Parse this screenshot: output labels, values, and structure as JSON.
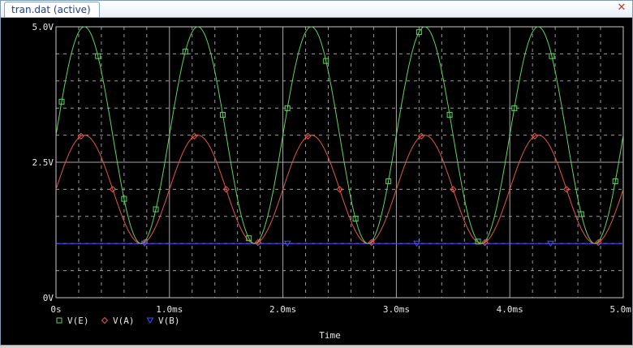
{
  "window": {
    "tab_title": "tran.dat (active)",
    "close_icon": "close-icon"
  },
  "colors": {
    "background": "#000000",
    "grid_solid": "#a8a8a8",
    "grid_dotted": "#9a9a9a",
    "axis_text": "#e6e6e6",
    "series_e": "#5fd35f",
    "series_a": "#e0584b",
    "series_b": "#4a4aff"
  },
  "chart_data": {
    "type": "line",
    "xlabel": "Time",
    "ylabel": "",
    "xlim": [
      0,
      5.0
    ],
    "ylim": [
      0,
      5.0
    ],
    "x_ticks": [
      0,
      1.0,
      2.0,
      3.0,
      4.0,
      5.0
    ],
    "x_tick_labels": [
      "0s",
      "1.0ms",
      "2.0ms",
      "3.0ms",
      "4.0ms",
      "5.0ms"
    ],
    "y_ticks": [
      0,
      2.5,
      5.0
    ],
    "y_tick_labels": [
      "0V",
      "2.5V",
      "5.0V"
    ],
    "x_unit": "ms",
    "grid": true,
    "legend_position": "bottom-left",
    "series": [
      {
        "name": "V(E)",
        "marker": "square",
        "color": "#5fd35f",
        "x": [
          0,
          0.125,
          0.25,
          0.375,
          0.5,
          0.625,
          0.75,
          0.875,
          1.0,
          1.125,
          1.25,
          1.375,
          1.5,
          1.625,
          1.75,
          1.875,
          2.0,
          2.125,
          2.25,
          2.375,
          2.5,
          2.625,
          2.75,
          2.875,
          3.0,
          3.125,
          3.25,
          3.375,
          3.5,
          3.625,
          3.75,
          3.875,
          4.0,
          4.125,
          4.25,
          4.375,
          4.5,
          4.625,
          4.75,
          4.875,
          5.0
        ],
        "y": [
          3.0,
          4.41,
          5.0,
          4.41,
          3.0,
          1.59,
          1.0,
          1.59,
          3.0,
          4.41,
          5.0,
          4.41,
          3.0,
          1.59,
          1.0,
          1.59,
          3.0,
          4.41,
          5.0,
          4.41,
          3.0,
          1.59,
          1.0,
          1.59,
          3.0,
          4.41,
          5.0,
          4.41,
          3.0,
          1.59,
          1.0,
          1.59,
          3.0,
          4.41,
          5.0,
          4.41,
          3.0,
          1.59,
          1.0,
          1.59,
          3.0
        ]
      },
      {
        "name": "V(A)",
        "marker": "diamond",
        "color": "#e0584b",
        "x": [
          0,
          0.125,
          0.25,
          0.375,
          0.5,
          0.625,
          0.75,
          0.875,
          1.0,
          1.125,
          1.25,
          1.375,
          1.5,
          1.625,
          1.75,
          1.875,
          2.0,
          2.125,
          2.25,
          2.375,
          2.5,
          2.625,
          2.75,
          2.875,
          3.0,
          3.125,
          3.25,
          3.375,
          3.5,
          3.625,
          3.75,
          3.875,
          4.0,
          4.125,
          4.25,
          4.375,
          4.5,
          4.625,
          4.75,
          4.875,
          5.0
        ],
        "y": [
          2.0,
          2.71,
          3.0,
          2.71,
          2.0,
          1.29,
          1.0,
          1.29,
          2.0,
          2.71,
          3.0,
          2.71,
          2.0,
          1.29,
          1.0,
          1.29,
          2.0,
          2.71,
          3.0,
          2.71,
          2.0,
          1.29,
          1.0,
          1.29,
          2.0,
          2.71,
          3.0,
          2.71,
          2.0,
          1.29,
          1.0,
          1.29,
          2.0,
          2.71,
          3.0,
          2.71,
          2.0,
          1.29,
          1.0,
          1.29,
          2.0
        ]
      },
      {
        "name": "V(B)",
        "marker": "triangle-down",
        "color": "#4a4aff",
        "x": [
          0,
          5.0
        ],
        "y": [
          1.0,
          1.0
        ]
      }
    ],
    "marker_x": {
      "V(E)": [
        0.05,
        0.37,
        0.6,
        0.88,
        1.14,
        1.47,
        1.7,
        2.04,
        2.38,
        2.64,
        2.93,
        3.2,
        3.47,
        3.72,
        4.04,
        4.37,
        4.63,
        4.93
      ],
      "V(A)": [
        0.22,
        0.5,
        0.78,
        1.22,
        1.5,
        1.78,
        2.22,
        2.5,
        2.78,
        3.22,
        3.5,
        3.78,
        4.22,
        4.5,
        4.78
      ],
      "V(B)": [
        0.78,
        2.04,
        3.18,
        4.36
      ]
    }
  }
}
